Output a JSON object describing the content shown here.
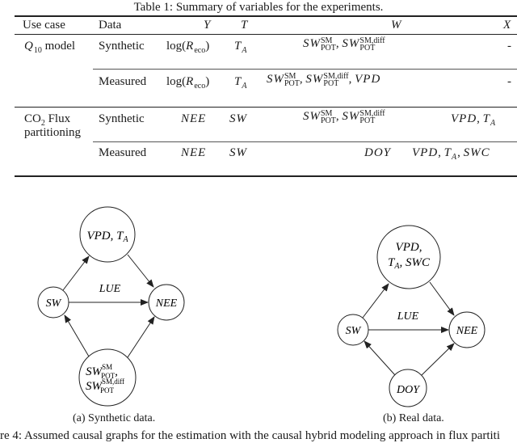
{
  "table": {
    "caption": "Table 1: Summary of variables for the experiments.",
    "headers": {
      "use_case": "Use case",
      "data": "Data",
      "y": "Y",
      "t": "T",
      "w": "W",
      "x": "X"
    },
    "rows": [
      {
        "use_case": "Q10 model",
        "data": "Synthetic",
        "y": "log(R_eco)",
        "t": "T_A",
        "w": "SW_POT^SM, SW_POT^SM,diff",
        "x": "-"
      },
      {
        "use_case": "",
        "data": "Measured",
        "y": "log(R_eco)",
        "t": "T_A",
        "w": "SW_POT^SM, SW_POT^SM,diff, VPD",
        "x": "-"
      },
      {
        "use_case": "CO2 Flux partitioning",
        "data": "Synthetic",
        "y": "NEE",
        "t": "SW",
        "w": "SW_POT^SM, SW_POT^SM,diff",
        "x": "VPD, T_A"
      },
      {
        "use_case": "",
        "data": "Measured",
        "y": "NEE",
        "t": "SW",
        "w": "DOY",
        "x": "VPD, T_A, SWC"
      }
    ],
    "labels": {
      "q10_model": "model",
      "co2_flux": "Flux",
      "partitioning": "partitioning",
      "synthetic": "Synthetic",
      "measured": "Measured",
      "log": "log(",
      "R": "R",
      "eco": "eco",
      "close": ")",
      "T": "T",
      "A": "A",
      "SW": "SW",
      "SM": "SM",
      "SMdiff": "SM,diff",
      "POT": "POT",
      "VPD": "VPD",
      "NEE": "NEE",
      "DOY": "DOY",
      "SWC": "SWC",
      "dash": "-",
      "comma": ", "
    }
  },
  "figure": {
    "graph_a": {
      "nodes": {
        "top": "VPD, T_A",
        "left": "SW",
        "right": "NEE",
        "bottom": "SW_POT^SM, SW_POT^SM,diff"
      },
      "edge_label": "LUE",
      "subcaption": "(a) Synthetic data."
    },
    "graph_b": {
      "nodes": {
        "top": "VPD, T_A, SWC",
        "left": "SW",
        "right": "NEE",
        "bottom": "DOY"
      },
      "edge_label": "LUE",
      "subcaption": "(b) Real data."
    },
    "caption": "re 4: Assumed causal graphs for the estimation with the causal hybrid modeling approach in flux partiti"
  }
}
